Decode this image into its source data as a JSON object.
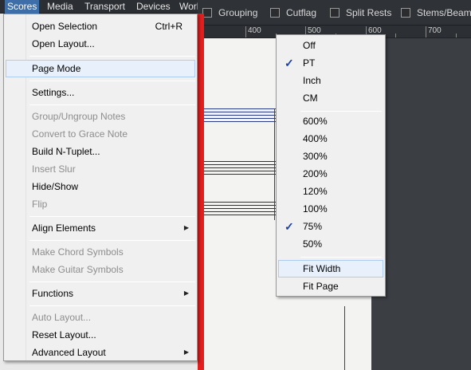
{
  "menubar": {
    "items": [
      "Scores",
      "Media",
      "Transport",
      "Devices",
      "Work"
    ]
  },
  "toolbar": {
    "checks": [
      "Grouping",
      "Cutflag",
      "Split Rests",
      "Stems/Beams"
    ]
  },
  "ruler": {
    "labels": [
      "400",
      "500",
      "600",
      "700"
    ]
  },
  "scores_menu": {
    "items": [
      {
        "label": "Open Selection",
        "shortcut": "Ctrl+R"
      },
      {
        "label": "Open Layout..."
      },
      {
        "label": "Page Mode"
      },
      {
        "label": "Settings..."
      },
      {
        "label": "Group/Ungroup Notes"
      },
      {
        "label": "Convert to Grace Note"
      },
      {
        "label": "Build N-Tuplet..."
      },
      {
        "label": "Insert Slur"
      },
      {
        "label": "Hide/Show"
      },
      {
        "label": "Flip"
      },
      {
        "label": "Align Elements"
      },
      {
        "label": "Make Chord Symbols"
      },
      {
        "label": "Make Guitar Symbols"
      },
      {
        "label": "Functions"
      },
      {
        "label": "Auto Layout..."
      },
      {
        "label": "Reset Layout..."
      },
      {
        "label": "Advanced Layout"
      }
    ]
  },
  "unit_menu": {
    "items": [
      "Off",
      "PT",
      "Inch",
      "CM",
      "600%",
      "400%",
      "300%",
      "200%",
      "120%",
      "100%",
      "75%",
      "50%",
      "Fit Width",
      "Fit Page"
    ],
    "checked": [
      "PT",
      "75%"
    ],
    "highlighted": "Fit Width"
  },
  "colors": {
    "accent": "#3e6ea8",
    "menu_highlight": "#e8f1fb",
    "red_bar": "#e21e1e"
  }
}
